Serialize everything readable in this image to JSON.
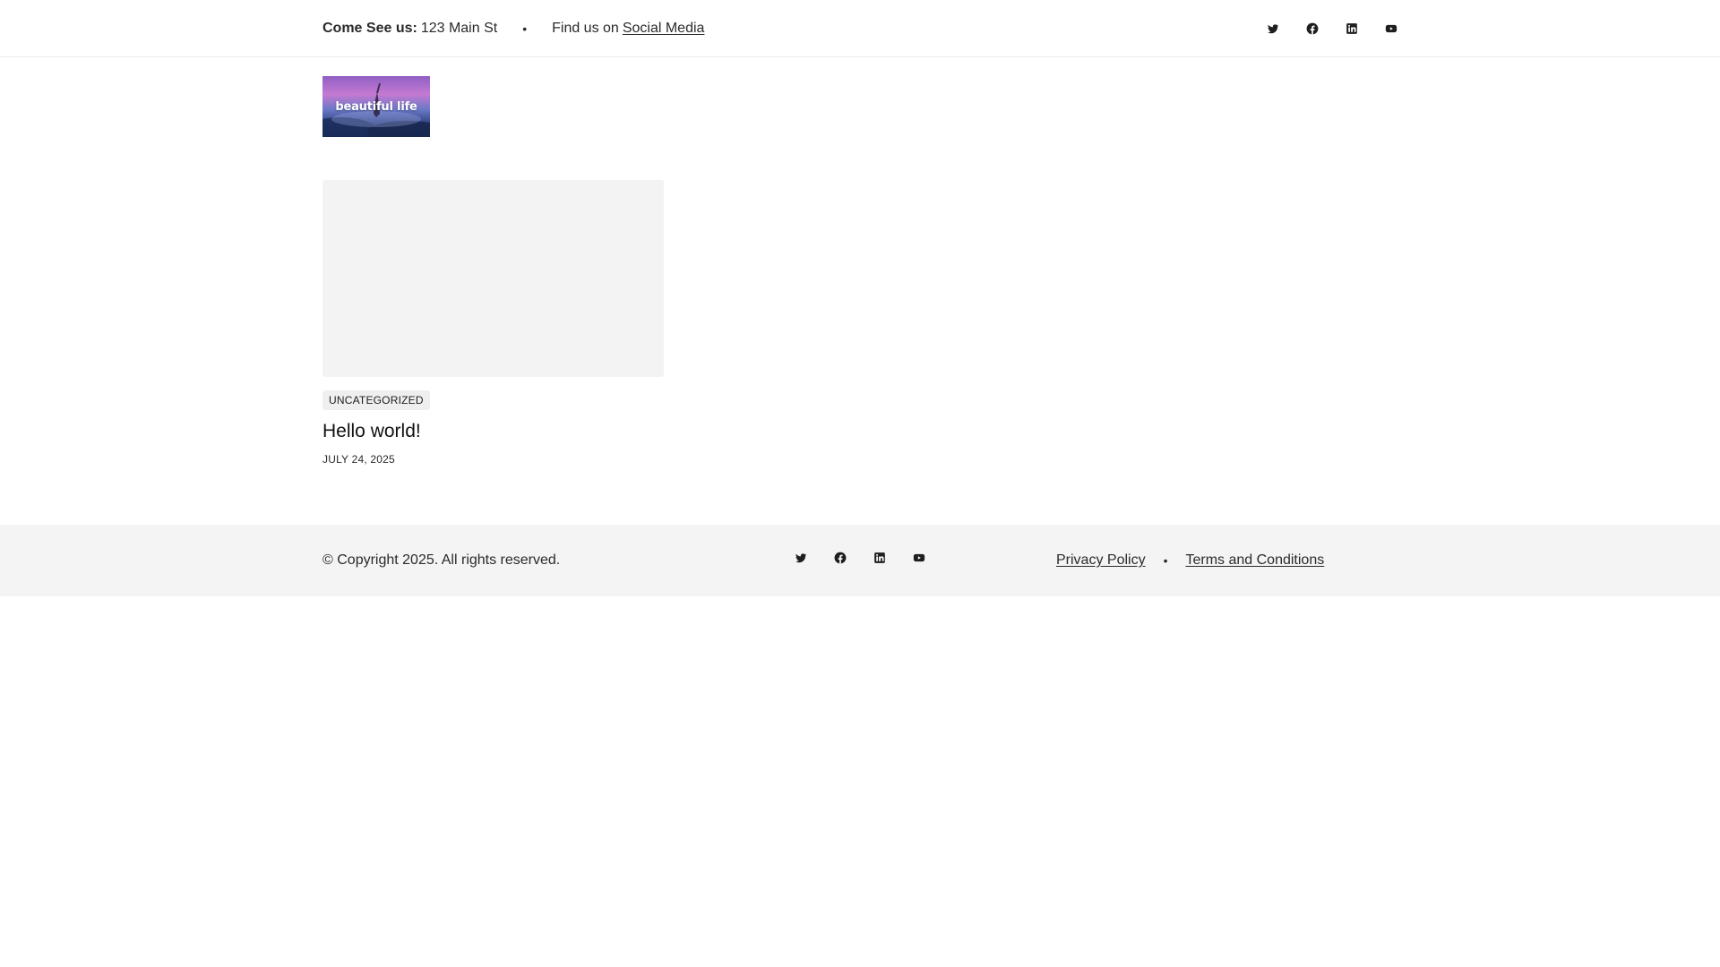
{
  "topbar": {
    "address_label": "Come See us:",
    "address_value": "123 Main St",
    "separator": "•",
    "social_prefix": "Find us on",
    "social_link": "Social Media",
    "social_icons": [
      "twitter-icon",
      "facebook-icon",
      "linkedin-icon",
      "youtube-icon"
    ]
  },
  "logo": {
    "text": "beautiful life"
  },
  "post": {
    "category": "Uncategorized",
    "title": "Hello world!",
    "date": "July 24, 2025"
  },
  "footer": {
    "copyright": "© Copyright 2025. All rights reserved.",
    "social_icons": [
      "twitter-icon",
      "facebook-icon",
      "linkedin-icon",
      "youtube-icon"
    ],
    "links": {
      "privacy": "Privacy Policy",
      "separator": "•",
      "terms": "Terms and Conditions"
    }
  },
  "colors": {
    "text": "#1e1e1e",
    "footer_bg": "#f4f4f4",
    "thumb_bg": "#f3f3f3",
    "category_bg": "#efefef"
  }
}
